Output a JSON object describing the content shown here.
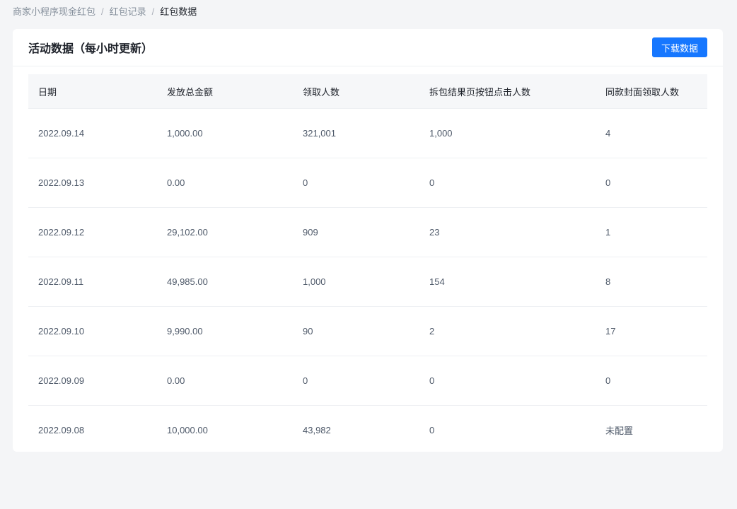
{
  "breadcrumb": {
    "items": [
      "商家小程序现金红包",
      "红包记录"
    ],
    "separator": "/",
    "current": "红包数据"
  },
  "card": {
    "title": "活动数据（每小时更新）",
    "download_button": "下载数据"
  },
  "table": {
    "columns": [
      "日期",
      "发放总金额",
      "领取人数",
      "拆包结果页按钮点击人数",
      "同款封面领取人数"
    ],
    "rows": [
      [
        "2022.09.14",
        "1,000.00",
        "321,001",
        "1,000",
        "4"
      ],
      [
        "2022.09.13",
        "0.00",
        "0",
        "0",
        "0"
      ],
      [
        "2022.09.12",
        "29,102.00",
        "909",
        "23",
        "1"
      ],
      [
        "2022.09.11",
        "49,985.00",
        "1,000",
        "154",
        "8"
      ],
      [
        "2022.09.10",
        "9,990.00",
        "90",
        "2",
        "17"
      ],
      [
        "2022.09.09",
        "0.00",
        "0",
        "0",
        "0"
      ],
      [
        "2022.09.08",
        "10,000.00",
        "43,982",
        "0",
        "未配置"
      ]
    ]
  },
  "colors": {
    "primary": "#1677ff",
    "background": "#f4f5f7",
    "header_bg": "#f6f7f9"
  }
}
